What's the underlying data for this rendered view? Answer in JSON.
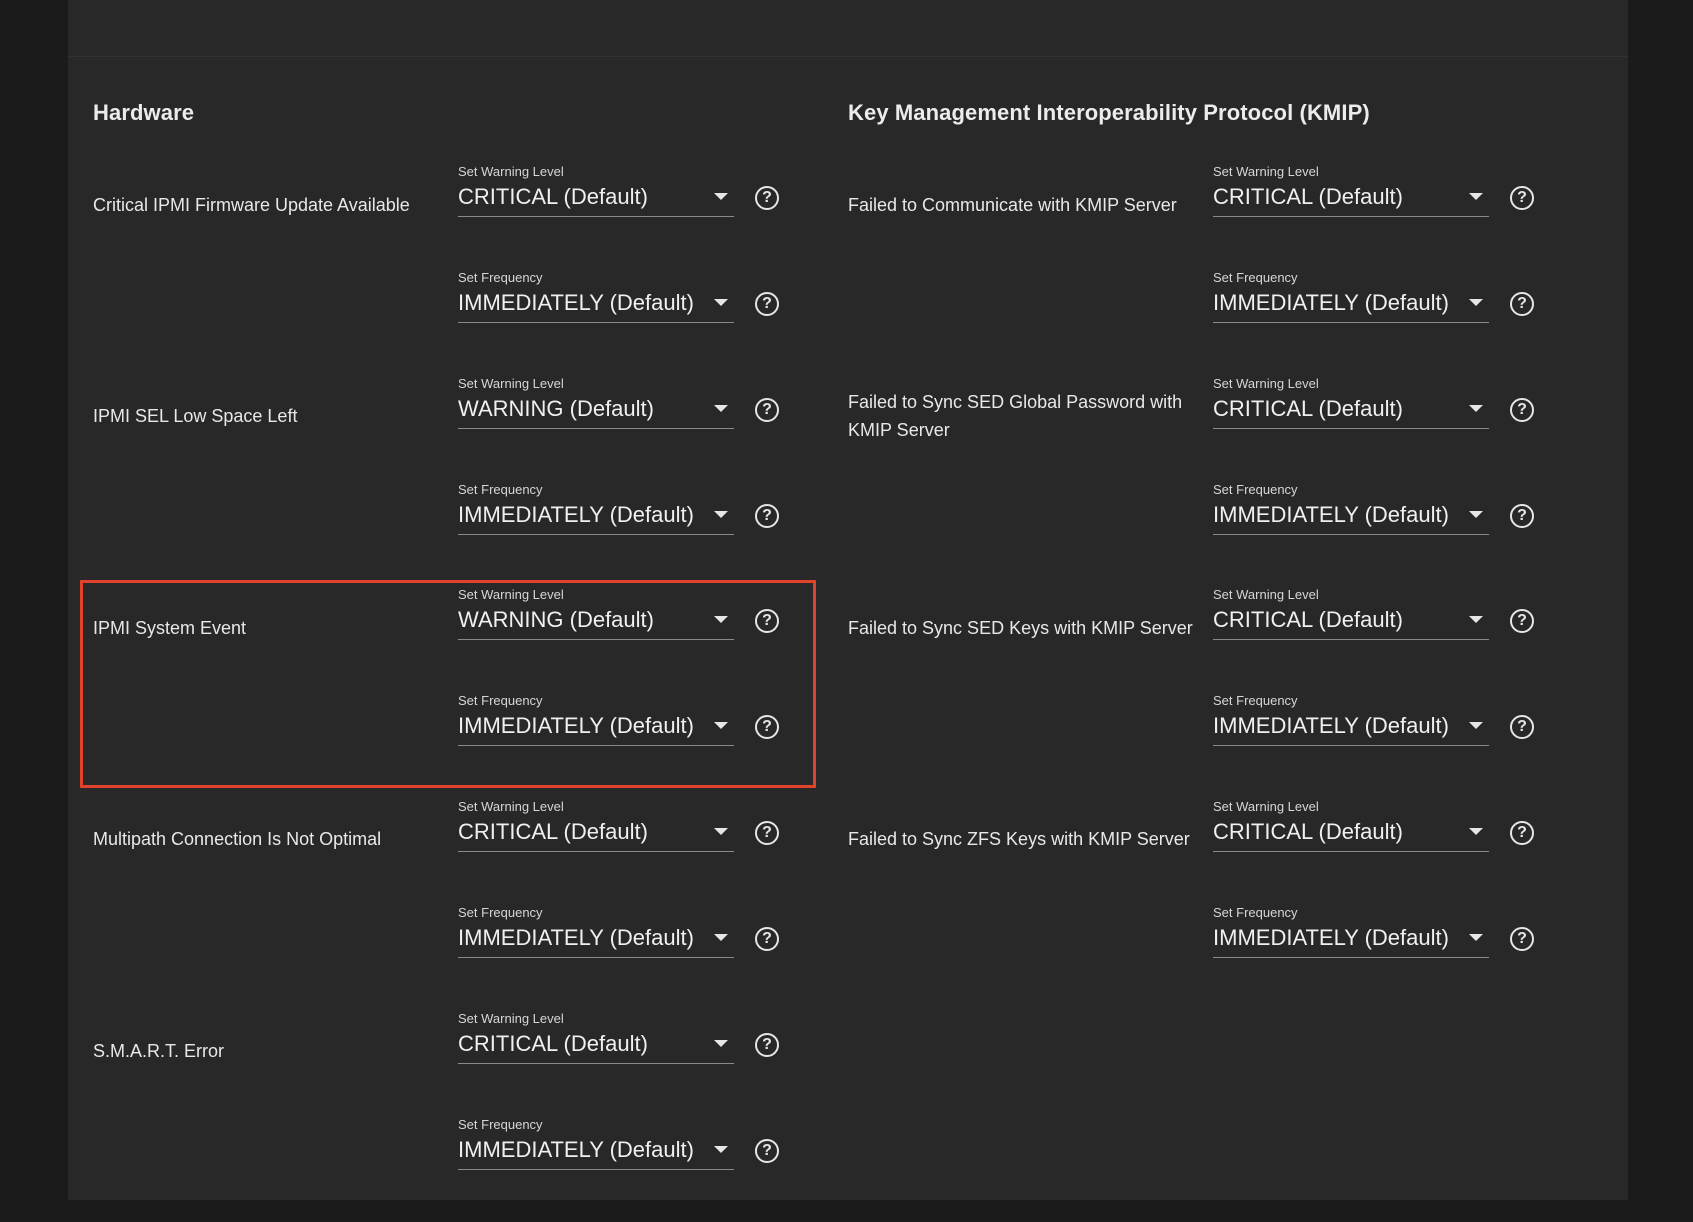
{
  "sections": {
    "hardware": {
      "title": "Hardware",
      "alerts": [
        {
          "name": "Critical IPMI Firmware Update Available",
          "level_label": "Set Warning Level",
          "level": "CRITICAL (Default)",
          "freq_label": "Set Frequency",
          "freq": "IMMEDIATELY (Default)"
        },
        {
          "name": "IPMI SEL Low Space Left",
          "level_label": "Set Warning Level",
          "level": "WARNING (Default)",
          "freq_label": "Set Frequency",
          "freq": "IMMEDIATELY (Default)"
        },
        {
          "name": "IPMI System Event",
          "level_label": "Set Warning Level",
          "level": "WARNING (Default)",
          "freq_label": "Set Frequency",
          "freq": "IMMEDIATELY (Default)"
        },
        {
          "name": "Multipath Connection Is Not Optimal",
          "level_label": "Set Warning Level",
          "level": "CRITICAL (Default)",
          "freq_label": "Set Frequency",
          "freq": "IMMEDIATELY (Default)"
        },
        {
          "name": "S.M.A.R.T. Error",
          "level_label": "Set Warning Level",
          "level": "CRITICAL (Default)",
          "freq_label": "Set Frequency",
          "freq": "IMMEDIATELY (Default)"
        }
      ]
    },
    "kmip": {
      "title": "Key Management Interoperability Protocol (KMIP)",
      "alerts": [
        {
          "name": "Failed to Communicate with KMIP Server",
          "level_label": "Set Warning Level",
          "level": "CRITICAL (Default)",
          "freq_label": "Set Frequency",
          "freq": "IMMEDIATELY (Default)"
        },
        {
          "name": "Failed to Sync SED Global Password with KMIP Server",
          "level_label": "Set Warning Level",
          "level": "CRITICAL (Default)",
          "freq_label": "Set Frequency",
          "freq": "IMMEDIATELY (Default)"
        },
        {
          "name": "Failed to Sync SED Keys with KMIP Server",
          "level_label": "Set Warning Level",
          "level": "CRITICAL (Default)",
          "freq_label": "Set Frequency",
          "freq": "IMMEDIATELY (Default)"
        },
        {
          "name": "Failed to Sync ZFS Keys with KMIP Server",
          "level_label": "Set Warning Level",
          "level": "CRITICAL (Default)",
          "freq_label": "Set Frequency",
          "freq": "IMMEDIATELY (Default)"
        }
      ]
    }
  },
  "help_glyph": "?",
  "icons": {
    "dropdown": "chevron-down-icon",
    "help": "help-circle-icon"
  },
  "colors": {
    "background": "#282828",
    "highlight": "#e0432b",
    "text": "#e6e6e6"
  }
}
